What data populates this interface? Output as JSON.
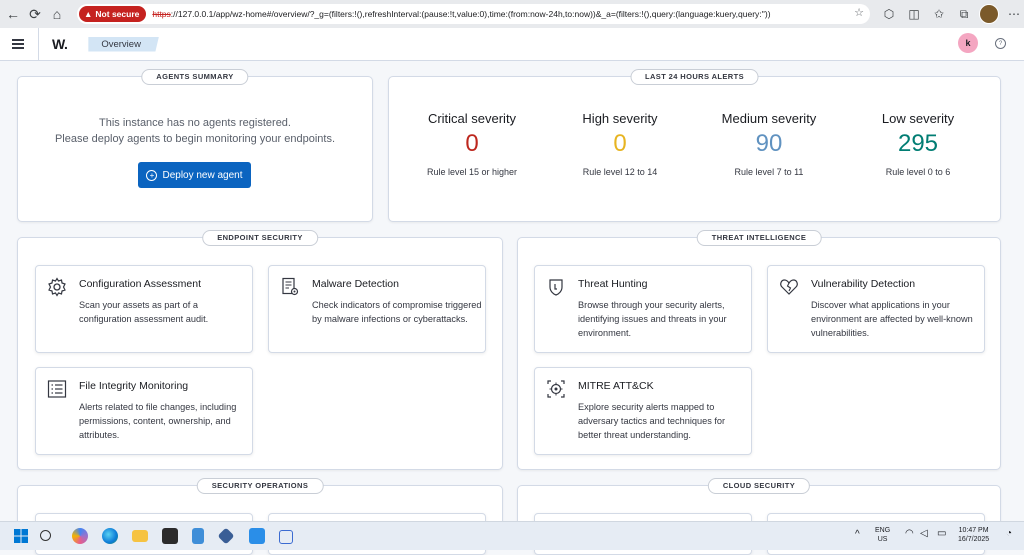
{
  "browser": {
    "security_label": "Not secure",
    "url_scheme": "https",
    "url_rest": "://127.0.0.1/app/wz-home#/overview/?_g=(filters:!(),refreshInterval:(pause:!t,value:0),time:(from:now-24h,to:now))&_a=(filters:!(),query:(language:kuery,query:''))"
  },
  "header": {
    "logo": "W.",
    "breadcrumb": "Overview",
    "avatar_initial": "k"
  },
  "agents_summary": {
    "title": "AGENTS SUMMARY",
    "message_line1": "This instance has no agents registered.",
    "message_line2": "Please deploy agents to begin monitoring your endpoints.",
    "deploy_button": "Deploy new agent"
  },
  "alerts": {
    "title": "LAST 24 HOURS ALERTS",
    "items": [
      {
        "label": "Critical severity",
        "value": "0",
        "rule": "Rule level 15 or higher",
        "color": "#bd271e"
      },
      {
        "label": "High severity",
        "value": "0",
        "rule": "Rule level 12 to 14",
        "color": "#e7b421"
      },
      {
        "label": "Medium severity",
        "value": "90",
        "rule": "Rule level 7 to 11",
        "color": "#6092c0"
      },
      {
        "label": "Low severity",
        "value": "295",
        "rule": "Rule level 0 to 6",
        "color": "#017d73"
      }
    ]
  },
  "endpoint_security": {
    "title": "ENDPOINT SECURITY",
    "cards": [
      {
        "title": "Configuration Assessment",
        "desc": "Scan your assets as part of a configuration assessment audit.",
        "icon": "gear-icon"
      },
      {
        "title": "Malware Detection",
        "desc": "Check indicators of compromise triggered by malware infections or cyberattacks.",
        "icon": "document-gear-icon"
      },
      {
        "title": "File Integrity Monitoring",
        "desc": "Alerts related to file changes, including permissions, content, ownership, and attributes.",
        "icon": "list-icon"
      }
    ]
  },
  "threat_intelligence": {
    "title": "THREAT INTELLIGENCE",
    "cards": [
      {
        "title": "Threat Hunting",
        "desc": "Browse through your security alerts, identifying issues and threats in your environment.",
        "icon": "shield-icon"
      },
      {
        "title": "Vulnerability Detection",
        "desc": "Discover what applications in your environment are affected by well-known vulnerabilities.",
        "icon": "heart-icon"
      },
      {
        "title": "MITRE ATT&CK",
        "desc": "Explore security alerts mapped to adversary tactics and techniques for better threat understanding.",
        "icon": "target-icon"
      }
    ]
  },
  "security_operations": {
    "title": "SECURITY OPERATIONS"
  },
  "cloud_security": {
    "title": "CLOUD SECURITY"
  },
  "taskbar": {
    "language": "ENG",
    "region": "US",
    "time": "10:47 PM",
    "date": "16/7/2025"
  }
}
